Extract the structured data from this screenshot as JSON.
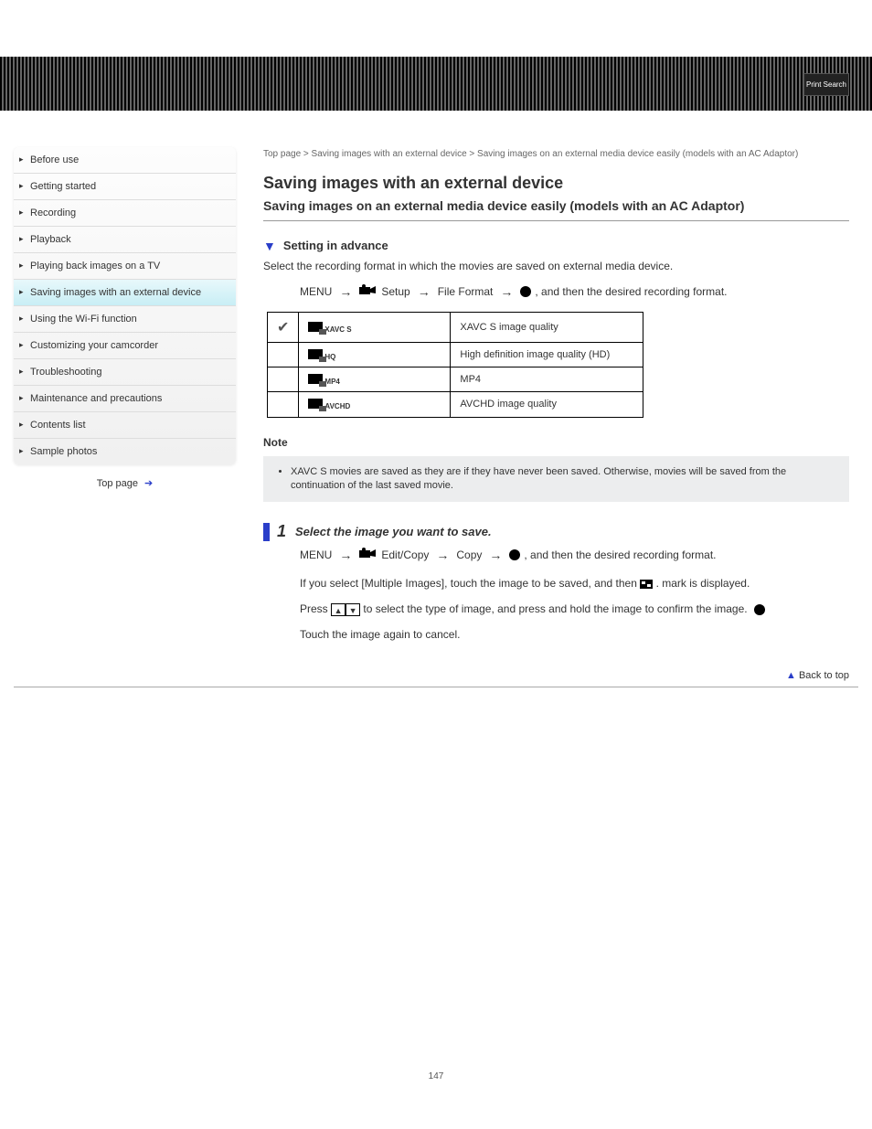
{
  "header": {
    "badge": "Print Search"
  },
  "sidebar": {
    "items": [
      {
        "label": "Before use"
      },
      {
        "label": "Getting started"
      },
      {
        "label": "Recording"
      },
      {
        "label": "Playback"
      },
      {
        "label": "Playing back images on a TV"
      },
      {
        "label": "Saving images with an external device"
      },
      {
        "label": "Using the Wi-Fi function"
      },
      {
        "label": "Customizing your camcorder"
      },
      {
        "label": "Troubleshooting"
      },
      {
        "label": "Maintenance and precautions"
      },
      {
        "label": "Contents list"
      },
      {
        "label": "Sample photos"
      }
    ],
    "active_index": 5,
    "footer": "Top page"
  },
  "breadcrumb": "Top page > Saving images with an external device > Saving images on an external media device easily (models with an AC Adaptor)",
  "h1": "Saving images with an external device",
  "h2": "Saving images on an external media device easily (models with an AC Adaptor)",
  "section1": {
    "title": "Setting in advance",
    "para": "Select the recording format in which the movies are saved on external media device.",
    "menu_path": [
      "MENU",
      "Setup",
      "File Format",
      ", and then the desired recording format."
    ],
    "table": [
      {
        "check": true,
        "sub": "",
        "label_sub": "XAVC S",
        "desc": "XAVC S image quality"
      },
      {
        "check": false,
        "sub": "",
        "label_sub": "HQ",
        "desc": "High definition image quality (HD)"
      },
      {
        "check": false,
        "sub": "MP4",
        "label_sub": "",
        "desc": "MP4"
      },
      {
        "check": false,
        "sub": "AVCHD",
        "label_sub": "",
        "desc": "AVCHD image quality"
      }
    ],
    "note_title": "Note",
    "note": "XAVC S movies are saved as they are if they have never been saved. Otherwise, movies will be saved from the continuation of the last saved movie."
  },
  "step": {
    "num": "1",
    "text": "Select the image you want to save.",
    "menu_path": [
      "MENU",
      "Edit/Copy",
      "Copy",
      ", and then the desired recording format."
    ],
    "para2_pre": "If you select [Multiple Images], touch the image to be saved, and then",
    "para2_post": ". mark is displayed.",
    "para3_pre": "Press",
    "para3_post": "to select the type of image, and press and hold the image to confirm the image.",
    "para4": "Touch the image again to cancel."
  },
  "backtotop": "Back to top",
  "pagenum": "147"
}
